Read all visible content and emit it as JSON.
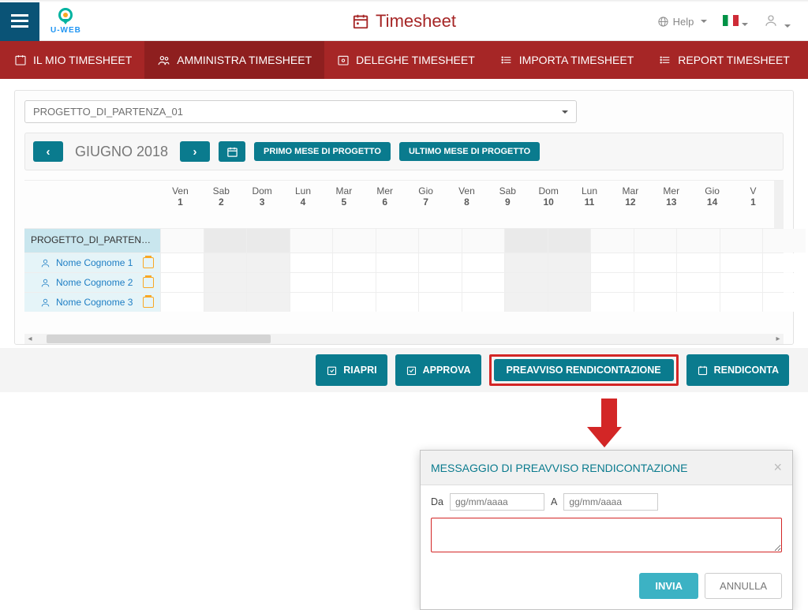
{
  "brand": {
    "text": "U-WEB"
  },
  "app_title": "Timesheet",
  "header": {
    "help": "Help"
  },
  "nav": {
    "my": "IL MIO TIMESHEET",
    "admin": "AMMINISTRA TIMESHEET",
    "deleghe": "DELEGHE TIMESHEET",
    "importa": "IMPORTA TIMESHEET",
    "report": "REPORT TIMESHEET"
  },
  "project_select": "PROGETTO_DI_PARTENZA_01",
  "controls": {
    "month": "GIUGNO 2018",
    "primo": "PRIMO MESE DI PROGETTO",
    "ultimo": "ULTIMO MESE DI PROGETTO"
  },
  "days": [
    {
      "dow": "Ven",
      "num": "1",
      "we": false
    },
    {
      "dow": "Sab",
      "num": "2",
      "we": true
    },
    {
      "dow": "Dom",
      "num": "3",
      "we": true
    },
    {
      "dow": "Lun",
      "num": "4",
      "we": false
    },
    {
      "dow": "Mar",
      "num": "5",
      "we": false
    },
    {
      "dow": "Mer",
      "num": "6",
      "we": false
    },
    {
      "dow": "Gio",
      "num": "7",
      "we": false
    },
    {
      "dow": "Ven",
      "num": "8",
      "we": false
    },
    {
      "dow": "Sab",
      "num": "9",
      "we": true
    },
    {
      "dow": "Dom",
      "num": "10",
      "we": true
    },
    {
      "dow": "Lun",
      "num": "11",
      "we": false
    },
    {
      "dow": "Mar",
      "num": "12",
      "we": false
    },
    {
      "dow": "Mer",
      "num": "13",
      "we": false
    },
    {
      "dow": "Gio",
      "num": "14",
      "we": false
    },
    {
      "dow": "V",
      "num": "1",
      "we": false
    }
  ],
  "rows": {
    "project": "PROGETTO_DI_PARTENZ...",
    "people": [
      "Nome Cognome 1",
      "Nome Cognome 2",
      "Nome Cognome 3"
    ]
  },
  "actions": {
    "riapri": "RIAPRI",
    "approva": "APPROVA",
    "preavviso": "PREAVVISO RENDICONTAZIONE",
    "rendiconta": "RENDICONTA"
  },
  "modal": {
    "title": "MESSAGGIO DI PREAVVISO RENDICONTAZIONE",
    "da": "Da",
    "a": "A",
    "placeholder": "gg/mm/aaaa",
    "invia": "INVIA",
    "annulla": "ANNULLA"
  }
}
